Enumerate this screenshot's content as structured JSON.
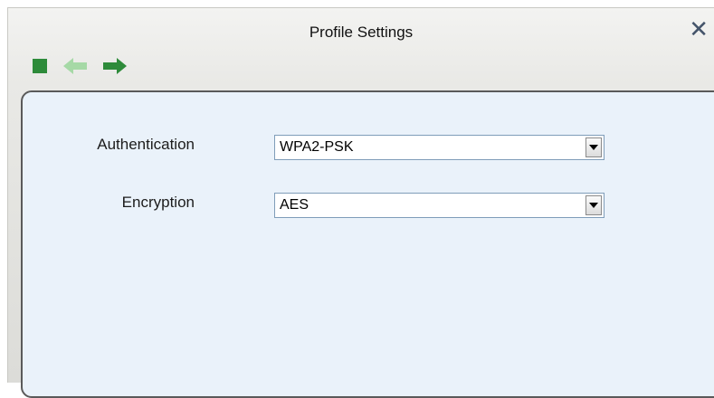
{
  "window": {
    "title": "Profile Settings",
    "close_icon": "close-icon"
  },
  "toolbar": {
    "items": [
      {
        "name": "stop-icon",
        "color": "#2e8b3a"
      },
      {
        "name": "back-arrow-icon",
        "color": "#a6d9a6"
      },
      {
        "name": "forward-arrow-icon",
        "color": "#2e8b3a"
      }
    ]
  },
  "form": {
    "authentication": {
      "label": "Authentication",
      "value": "WPA2-PSK"
    },
    "encryption": {
      "label": "Encryption",
      "value": "AES"
    }
  },
  "colors": {
    "panel_background": "#eaf2fa",
    "panel_border": "#5a5a5a",
    "accent_green": "#2e8b3a"
  }
}
